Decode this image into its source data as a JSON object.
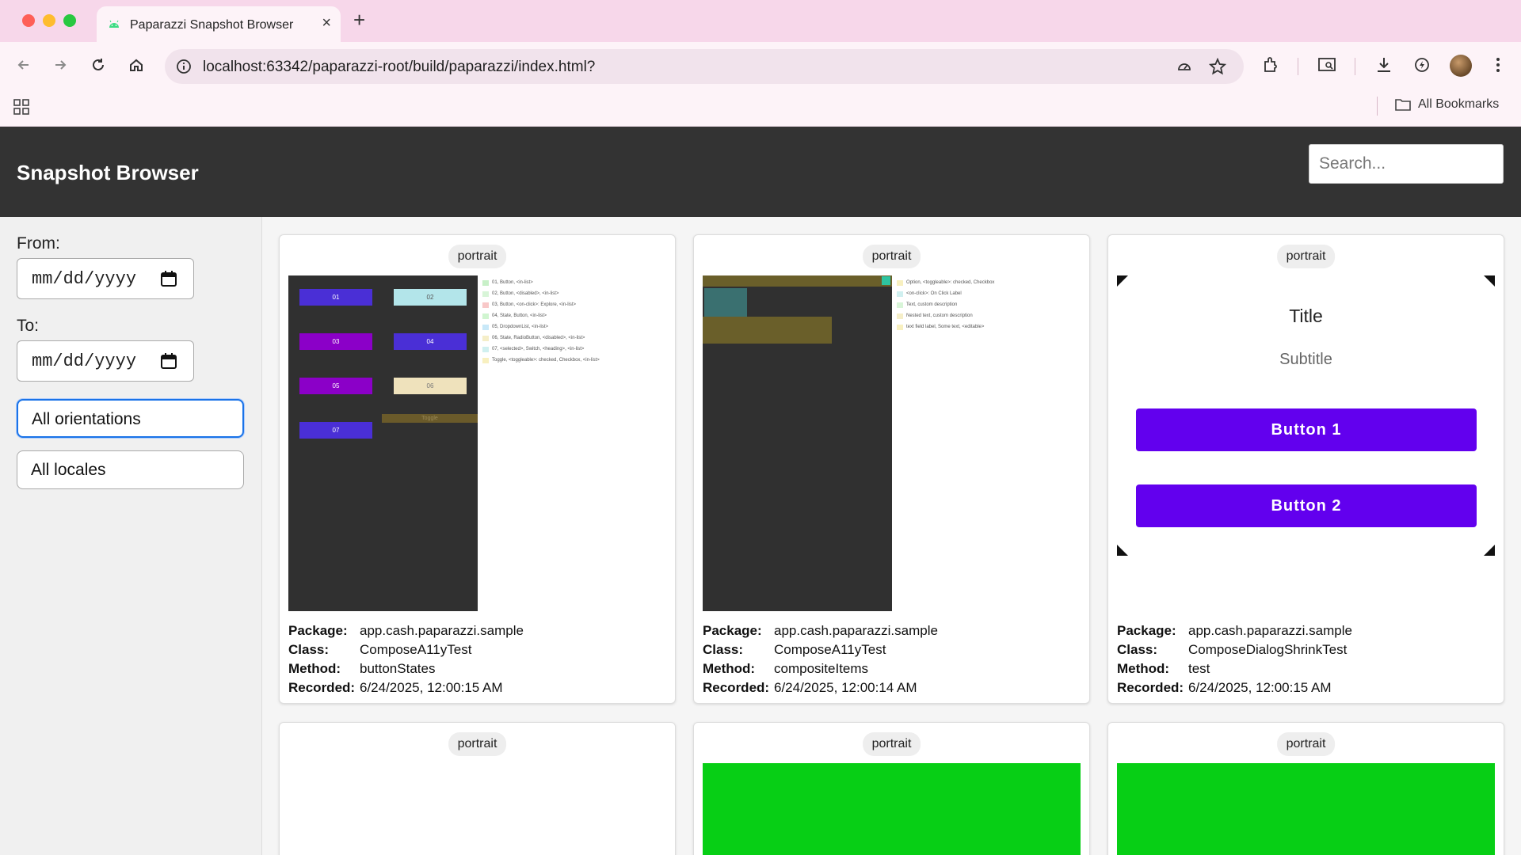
{
  "browser": {
    "tab_title": "Paparazzi Snapshot Browser",
    "url": "localhost:63342/paparazzi-root/build/paparazzi/index.html?",
    "all_bookmarks_label": "All Bookmarks"
  },
  "app": {
    "title": "Snapshot Browser",
    "search_placeholder": "Search..."
  },
  "filters": {
    "from_label": "From:",
    "to_label": "To:",
    "date_placeholder": "mm/dd/yyyy",
    "orientation_value": "All orientations",
    "locale_value": "All locales"
  },
  "meta_labels": {
    "package": "Package:",
    "class": "Class:",
    "method": "Method:",
    "recorded": "Recorded:"
  },
  "cards": [
    {
      "orientation": "portrait",
      "package": "app.cash.paparazzi.sample",
      "class": "ComposeA11yTest",
      "method": "buttonStates",
      "recorded": "6/24/2025, 12:00:15 AM",
      "preview": {
        "buttons": [
          "01",
          "02",
          "03",
          "04",
          "05",
          "06",
          "07"
        ],
        "toggle_label": "Toggle",
        "legend": [
          "01, Button, <in-list>",
          "02, Button, <disabled>, <in-list>",
          "03, Button, <on-click>: Explore, <in-list>",
          "04, State, Button, <in-list>",
          "05, DropdownList, <in-list>",
          "06, State, RadioButton, <disabled>, <in-list>",
          "07, <selected>, Switch, <heading>, <in-list>",
          "Toggle, <toggleable>: checked, Checkbox, <in-list>"
        ]
      }
    },
    {
      "orientation": "portrait",
      "package": "app.cash.paparazzi.sample",
      "class": "ComposeA11yTest",
      "method": "compositeItems",
      "recorded": "6/24/2025, 12:00:14 AM",
      "preview": {
        "legend": [
          "Option, <toggleable>: checked, Checkbox",
          "<on-click>: On Click Label",
          "Text, custom description",
          "Nested text, custom description",
          "text field label, Some text, <editable>"
        ]
      }
    },
    {
      "orientation": "portrait",
      "package": "app.cash.paparazzi.sample",
      "class": "ComposeDialogShrinkTest",
      "method": "test",
      "recorded": "6/24/2025, 12:00:15 AM",
      "preview": {
        "title": "Title",
        "subtitle": "Subtitle",
        "button1": "Button 1",
        "button2": "Button 2"
      }
    },
    {
      "orientation": "portrait"
    },
    {
      "orientation": "portrait"
    },
    {
      "orientation": "portrait"
    }
  ],
  "colors": {
    "header_bg": "#333333",
    "dialog_button": "#6200ee",
    "green_preview": "#07cf15",
    "tab_strip": "#f7d7ea"
  }
}
